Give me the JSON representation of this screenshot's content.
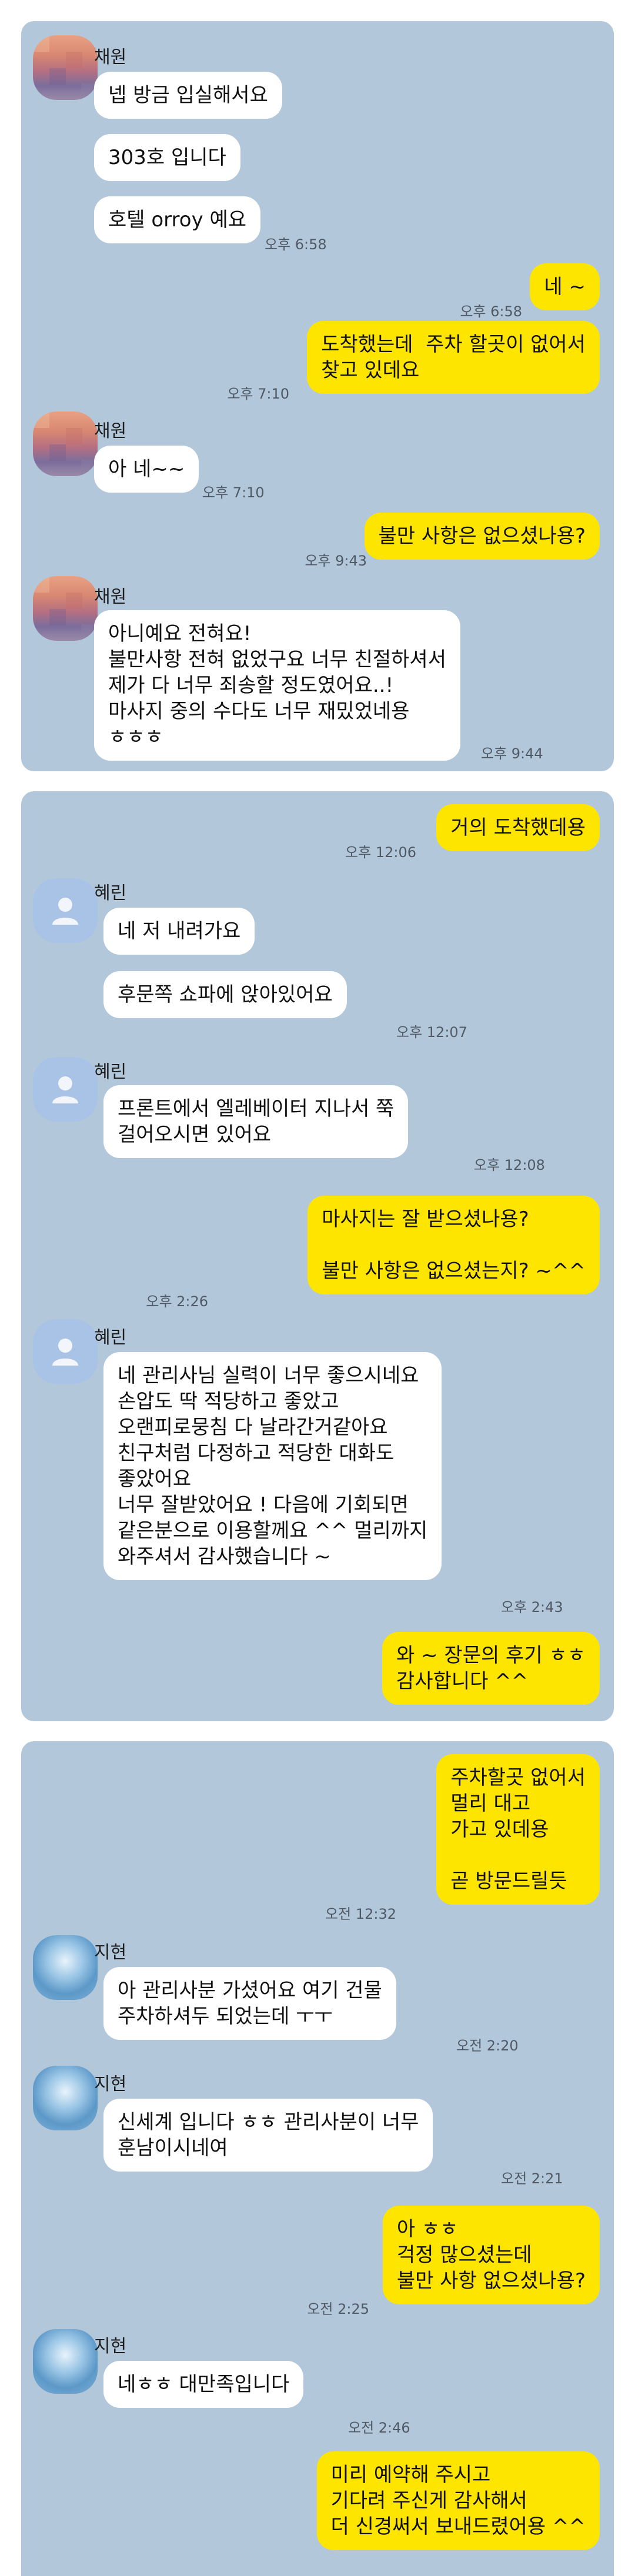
{
  "panel1": {
    "sender1": "채원",
    "m1": "넵 방금 입실해서요",
    "m2": "303호 입니다",
    "m3": "호텔 orroy 예요",
    "t3": "오후 6:58",
    "m4": "네 ~",
    "t4": "오후 6:58",
    "m5": "도착했는데  주차 할곳이 없어서\n찾고 있데요",
    "t5": "오후 7:10",
    "sender2": "채원",
    "m6": "아 네~~",
    "t6": "오후 7:10",
    "m7": "불만 사항은 없으셨나용?",
    "t7": "오후 9:43",
    "sender3": "채원",
    "m8": "아니예요 전혀요!\n불만사항 전혀 없었구요 너무 친절하셔서\n제가 다 너무 죄송할 정도였어요..!\n마사지 중의 수다도 너무 재밌었네용\nㅎㅎㅎ",
    "t8": "오후 9:44"
  },
  "panel2": {
    "m1": "거의 도착했데용",
    "t1": "오후 12:06",
    "sender1": "혜린",
    "m2": "네 저 내려가요",
    "m3": "후문쪽 쇼파에 앉아있어요",
    "t3": "오후 12:07",
    "sender2": "혜린",
    "m4": "프론트에서 엘레베이터 지나서 쭉\n걸어오시면 있어요",
    "t4": "오후 12:08",
    "m5": "마사지는 잘 받으셨나용?\n\n불만 사항은 없으셨는지? ~^^",
    "t5": "오후 2:26",
    "sender3": "혜린",
    "m6": "네 관리사님 실력이 너무 좋으시네요\n손압도 딱 적당하고 좋았고\n오랜피로뭉침 다 날라간거같아요\n친구처럼 다정하고 적당한 대화도\n좋았어요\n너무 잘받았어요 ! 다음에 기회되면\n같은분으로 이용할께요 ^^ 멀리까지\n와주셔서 감사했습니다 ~",
    "t6": "오후 2:43",
    "m7": "와 ~ 장문의 후기 ㅎㅎ\n감사합니다 ^^"
  },
  "panel3": {
    "m1": "주차할곳 없어서\n멀리 대고\n가고 있데용\n\n곧 방문드릴듯",
    "t1": "오전 12:32",
    "sender1": "지현",
    "m2": "아 관리사분 가셨어요 여기 건물\n주차하셔두 되었는데 ㅜㅜ",
    "t2": "오전 2:20",
    "sender2": "지현",
    "m3": "신세계 입니다 ㅎㅎ 관리사분이 너무\n훈남이시네여",
    "t3": "오전 2:21",
    "m4": "아 ㅎㅎ\n걱정 많으셨는데\n불만 사항 없으셨나용?",
    "t4": "오전 2:25",
    "sender3": "지현",
    "m5": "네ㅎㅎ 대만족입니다",
    "t5": "오전 2:46",
    "m6": "미리 예약해 주시고\n기다려 주신게 감사해서\n더 신경써서 보내드렸어용 ^^"
  },
  "colors": {
    "chat_bg": "#b2c7d9",
    "sent_bubble": "#fee500",
    "received_bubble": "#ffffff"
  },
  "icons": {
    "default_avatar": "person-icon"
  }
}
